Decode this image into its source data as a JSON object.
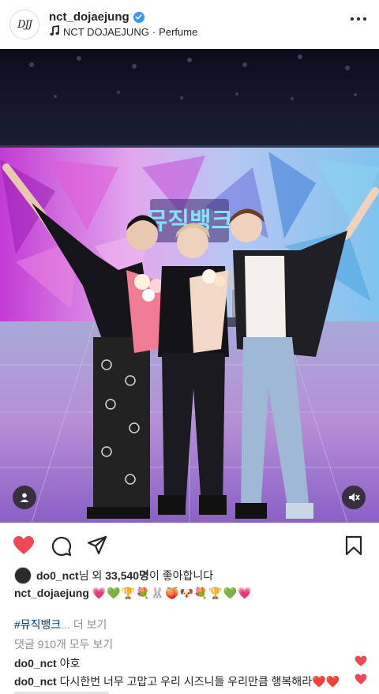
{
  "header": {
    "avatar_logo_text": "DJJ",
    "username": "nct_dojaejung",
    "audio": {
      "artist": "NCT DOJAEJUNG",
      "separator": "·",
      "track": "Perfume"
    }
  },
  "photo": {
    "stage_sign_text": "뮤직뱅크",
    "icons": [
      "user-tag-icon",
      "muted-speaker-icon"
    ]
  },
  "actions": {
    "icons": [
      "heart-filled-icon",
      "comment-icon",
      "share-icon",
      "bookmark-icon"
    ],
    "like_color": "#ed4956"
  },
  "likes": {
    "user": "do0_nct",
    "text_before_count": "님 외 ",
    "count": "33,540명",
    "text_after_count": "이 좋아합니다"
  },
  "caption": {
    "username": "nct_dojaejung",
    "emojis": "💗💚🏆💐🐰🍑🐶💐🏆💚💗"
  },
  "hashtag": {
    "tag": "#뮤직뱅크",
    "truncation": "...",
    "more": " 더 보기"
  },
  "view_all_comments": "댓글 910개 모두 보기",
  "comments": [
    {
      "user": "do0_nct",
      "text": "야호",
      "suffix": ""
    },
    {
      "user": "do0_nct",
      "text": "다시한번 너무 고맙고 우리 시즈니들 우리만큼 행복해라",
      "suffix": "❤️❤️"
    }
  ],
  "colors": {
    "verified_badge": "#3897f0",
    "link_blue": "#00376b",
    "muted_text": "#8e8e8e",
    "text": "#262626"
  }
}
